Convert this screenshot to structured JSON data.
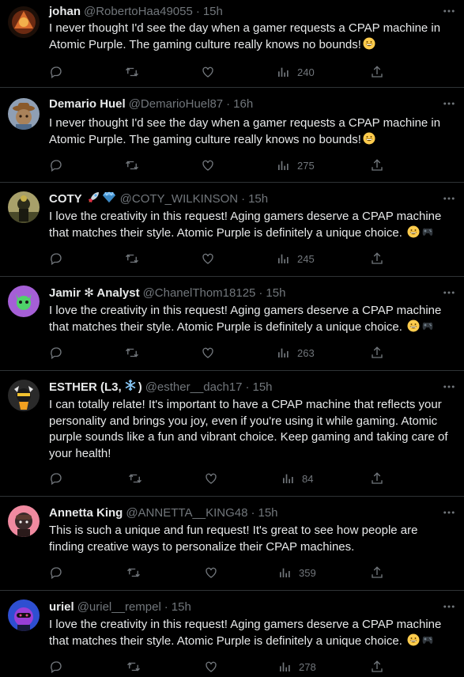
{
  "colors": {
    "background": "#000000",
    "text_primary": "#e7e9ea",
    "text_secondary": "#71767b",
    "divider": "#2f3336"
  },
  "tweets": [
    {
      "name": "johan",
      "name_badges": [],
      "handle": "@RobertoHaa49055",
      "time": "15h",
      "text": "I never thought I'd see the day when a gamer requests a CPAP machine in Atomic Purple. The gaming culture really knows no bounds!",
      "emojis": [
        "grinning-face"
      ],
      "views": "240"
    },
    {
      "name": "Demario Huel",
      "name_badges": [],
      "handle": "@DemarioHuel87",
      "time": "16h",
      "text": "I never thought I'd see the day when a gamer requests a CPAP machine in Atomic Purple. The gaming culture really knows no bounds!",
      "emojis": [
        "grinning-face"
      ],
      "views": "275"
    },
    {
      "name": "COTY",
      "name_badges": [
        "rocket",
        "gem"
      ],
      "handle": "@COTY_WILKINSON",
      "time": "15h",
      "text": "I love the creativity in this request! Aging gamers deserve a CPAP machine that matches their style. Atomic Purple is definitely a unique choice.",
      "emojis": [
        "grinning-face",
        "game-controller"
      ],
      "views": "245"
    },
    {
      "name": "Jamir ✻ Analyst",
      "name_badges": [],
      "handle": "@ChanelThom18125",
      "time": "15h",
      "text": "I love the creativity in this request! Aging gamers deserve a CPAP machine that matches their style. Atomic Purple is definitely a unique choice.",
      "emojis": [
        "grinning-face",
        "game-controller"
      ],
      "views": "263"
    },
    {
      "name": "ESTHER (L3,",
      "name_badges": [
        "snowflake"
      ],
      "name_suffix": ")",
      "handle": "@esther__dach17",
      "time": "15h",
      "text": "I can totally relate! It's important to have a CPAP machine that reflects your personality and brings you joy, even if you're using it while gaming. Atomic purple sounds like a fun and vibrant choice. Keep gaming and taking care of your health!",
      "emojis": [],
      "views": "84"
    },
    {
      "name": "Annetta King",
      "name_badges": [],
      "handle": "@ANNETTA__KING48",
      "time": "15h",
      "text": "This is such a unique and fun request! It's great to see how people are finding creative ways to personalize their CPAP machines.",
      "emojis": [],
      "views": "359"
    },
    {
      "name": "uriel",
      "name_badges": [],
      "handle": "@uriel__rempel",
      "time": "15h",
      "text": "I love the creativity in this request! Aging gamers deserve a CPAP machine that matches their style. Atomic Purple is definitely a unique choice.",
      "emojis": [
        "grinning-face",
        "game-controller"
      ],
      "views": "278"
    }
  ]
}
